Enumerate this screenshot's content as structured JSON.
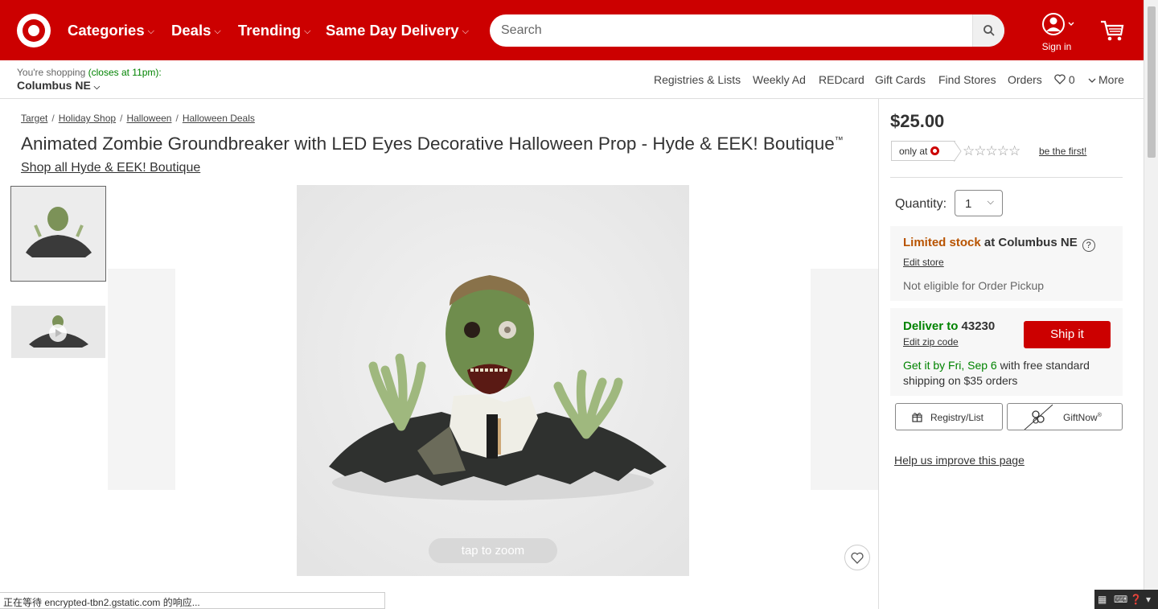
{
  "header": {
    "nav": [
      {
        "label": "Categories"
      },
      {
        "label": "Deals"
      },
      {
        "label": "Trending"
      },
      {
        "label": "Same Day Delivery"
      }
    ],
    "nav_chevron": "⌵",
    "search_placeholder": "Search",
    "signin_label": "Sign in",
    "brand_color": "#cc0000"
  },
  "subbar": {
    "shopping_prefix": "You're shopping",
    "closes": "(closes at 11pm):",
    "store": "Columbus NE",
    "store_chevron": "⌵",
    "links": [
      "Registries & Lists",
      "Weekly Ad",
      "REDcard",
      "Gift Cards",
      "Find Stores",
      "Orders"
    ],
    "favorites_count": "0",
    "more": "More"
  },
  "breadcrumbs": [
    "Target",
    "Holiday Shop",
    "Halloween",
    "Halloween Deals"
  ],
  "breadcrumb_sep": "/",
  "product": {
    "title": "Animated Zombie Groundbreaker with LED Eyes Decorative Halloween Prop - Hyde & EEK! Boutique",
    "trademark": "™",
    "shop_all": "Shop all Hyde & EEK! Boutique",
    "zoom_hint": "tap to zoom"
  },
  "rail": {
    "price": "$25.00",
    "only_at": "only at",
    "stars": "☆☆☆☆☆",
    "be_first": "be the first!",
    "quantity_label": "Quantity:",
    "quantity_value": "1",
    "quantity_chevron": "⌵",
    "stock_status": "Limited stock",
    "stock_location": " at Columbus NE",
    "help_glyph": "?",
    "edit_store": "Edit store",
    "pickup_note": "Not eligible for Order Pickup",
    "deliver_to": "Deliver to ",
    "zip": "43230",
    "edit_zip": "Edit zip code",
    "ship_button": "Ship it",
    "get_it_by": "Get it by Fri, Sep 6",
    "shipping_note": " with free standard shipping on $35 orders",
    "registry_button": "Registry/List",
    "giftnow_button": "GiftNow",
    "giftnow_mark": "®",
    "help_improve": "Help us improve this page"
  },
  "browser": {
    "status_text": "正在等待 encrypted-tbn2.gstatic.com 的响应..."
  }
}
